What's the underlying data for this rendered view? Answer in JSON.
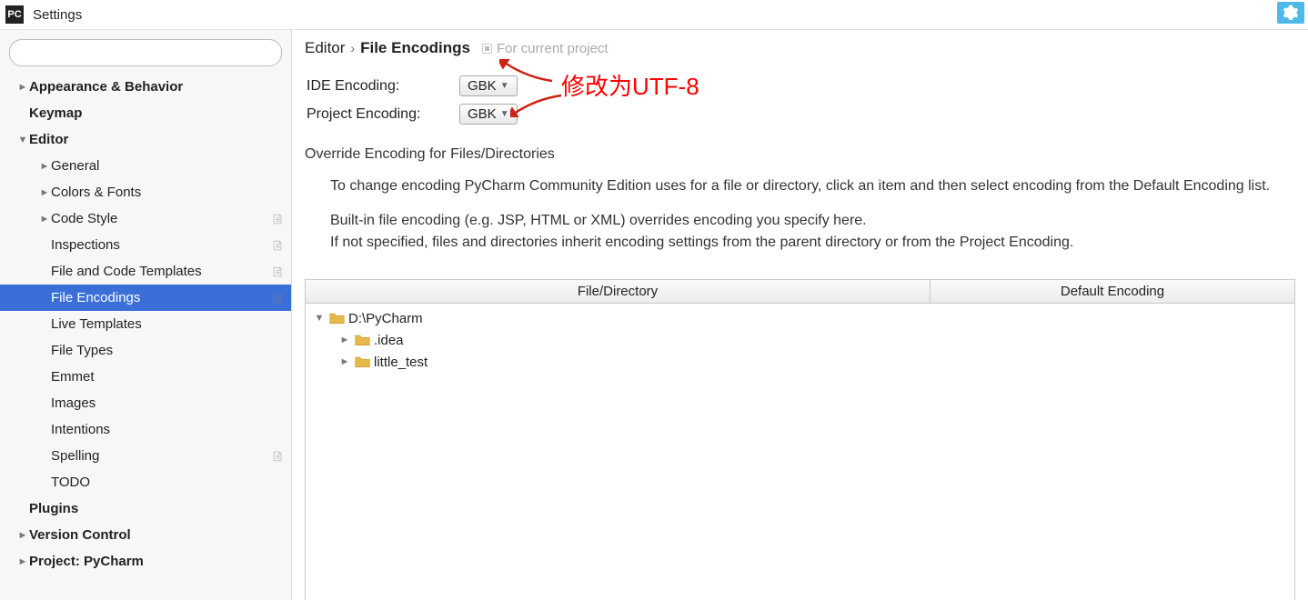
{
  "window": {
    "title": "Settings",
    "app_icon_text": "PC"
  },
  "search": {
    "placeholder": ""
  },
  "sidebar": {
    "items": [
      {
        "label": "Appearance & Behavior",
        "depth": 0,
        "arrow": "closed",
        "bold": true,
        "badge": false
      },
      {
        "label": "Keymap",
        "depth": 0,
        "arrow": "none",
        "bold": true,
        "badge": false
      },
      {
        "label": "Editor",
        "depth": 0,
        "arrow": "open",
        "bold": true,
        "badge": false
      },
      {
        "label": "General",
        "depth": 1,
        "arrow": "closed",
        "bold": false,
        "badge": false
      },
      {
        "label": "Colors & Fonts",
        "depth": 1,
        "arrow": "closed",
        "bold": false,
        "badge": false
      },
      {
        "label": "Code Style",
        "depth": 1,
        "arrow": "closed",
        "bold": false,
        "badge": true
      },
      {
        "label": "Inspections",
        "depth": 1,
        "arrow": "none",
        "bold": false,
        "badge": true
      },
      {
        "label": "File and Code Templates",
        "depth": 1,
        "arrow": "none",
        "bold": false,
        "badge": true
      },
      {
        "label": "File Encodings",
        "depth": 1,
        "arrow": "none",
        "bold": false,
        "badge": true,
        "selected": true
      },
      {
        "label": "Live Templates",
        "depth": 1,
        "arrow": "none",
        "bold": false,
        "badge": false
      },
      {
        "label": "File Types",
        "depth": 1,
        "arrow": "none",
        "bold": false,
        "badge": false
      },
      {
        "label": "Emmet",
        "depth": 1,
        "arrow": "none",
        "bold": false,
        "badge": false
      },
      {
        "label": "Images",
        "depth": 1,
        "arrow": "none",
        "bold": false,
        "badge": false
      },
      {
        "label": "Intentions",
        "depth": 1,
        "arrow": "none",
        "bold": false,
        "badge": false
      },
      {
        "label": "Spelling",
        "depth": 1,
        "arrow": "none",
        "bold": false,
        "badge": true
      },
      {
        "label": "TODO",
        "depth": 1,
        "arrow": "none",
        "bold": false,
        "badge": false
      },
      {
        "label": "Plugins",
        "depth": 0,
        "arrow": "none",
        "bold": true,
        "badge": false
      },
      {
        "label": "Version Control",
        "depth": 0,
        "arrow": "closed",
        "bold": true,
        "badge": false
      },
      {
        "label": "Project: PyCharm",
        "depth": 0,
        "arrow": "closed",
        "bold": true,
        "badge": false
      }
    ]
  },
  "breadcrumb": {
    "parent": "Editor",
    "current": "File Encodings",
    "scope": "For current project"
  },
  "form": {
    "ide_label": "IDE Encoding:",
    "ide_value": "GBK",
    "project_label": "Project Encoding:",
    "project_value": "GBK"
  },
  "override": {
    "title": "Override Encoding for Files/Directories",
    "p1": "To change encoding PyCharm Community Edition uses for a file or directory, click an item and then select encoding from the Default Encoding list.",
    "p2": "Built-in file encoding (e.g. JSP, HTML or XML) overrides encoding you specify here.",
    "p3": "If not specified, files and directories inherit encoding settings from the parent directory or from the Project Encoding."
  },
  "table": {
    "col_file": "File/Directory",
    "col_enc": "Default Encoding",
    "rows": [
      {
        "label": "D:\\PyCharm",
        "depth": 0,
        "arrow": "open"
      },
      {
        "label": ".idea",
        "depth": 1,
        "arrow": "closed"
      },
      {
        "label": "little_test",
        "depth": 1,
        "arrow": "closed"
      }
    ]
  },
  "annotation": {
    "text": "修改为UTF-8"
  }
}
